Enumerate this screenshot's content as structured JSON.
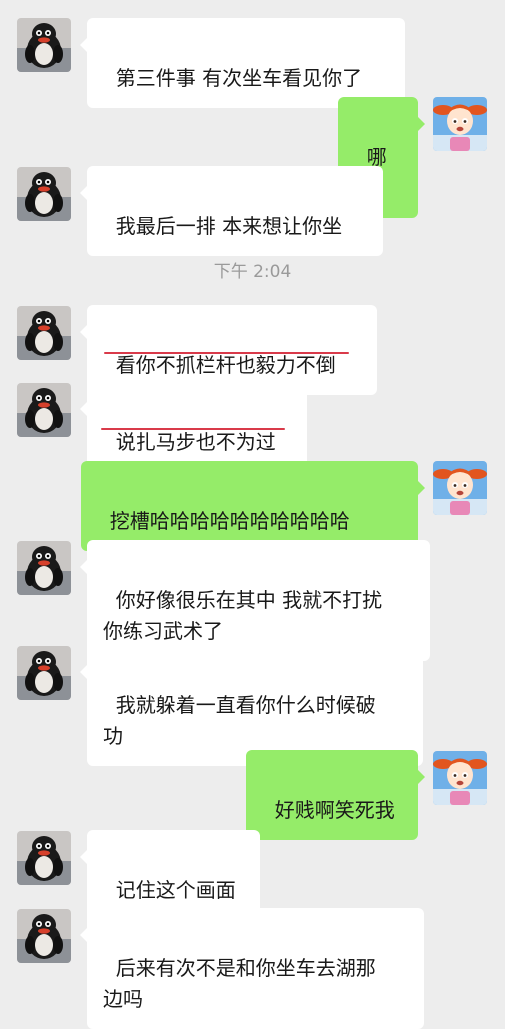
{
  "chat": {
    "timestamp": "下午 2:04",
    "messages": [
      {
        "side": "in",
        "text": "第三件事 有次坐车看见你了"
      },
      {
        "side": "out",
        "text": "哪天"
      },
      {
        "side": "in",
        "text": "我最后一排 本来想让你坐"
      },
      {
        "side": "in",
        "text": "看你不抓栏杆也毅力不倒"
      },
      {
        "side": "in",
        "text": "说扎马步也不为过"
      },
      {
        "side": "out",
        "text": "挖槽哈哈哈哈哈哈哈哈哈哈"
      },
      {
        "side": "in",
        "text": "你好像很乐在其中 我就不打扰\n你练习武术了"
      },
      {
        "side": "in",
        "text": "我就躲着一直看你什么时候破\n功"
      },
      {
        "side": "out",
        "text": "好贱啊笑死我"
      },
      {
        "side": "in",
        "text": "记住这个画面"
      },
      {
        "side": "in",
        "text": "后来有次不是和你坐车去湖那\n边吗"
      }
    ]
  },
  "colors": {
    "background": "#ededed",
    "incoming_bubble": "#ffffff",
    "outgoing_bubble": "#95ec69",
    "underline": "#d93a4a"
  },
  "avatars": {
    "contact": "penguin-avatar-icon",
    "self": "cartoon-girl-avatar-icon"
  }
}
